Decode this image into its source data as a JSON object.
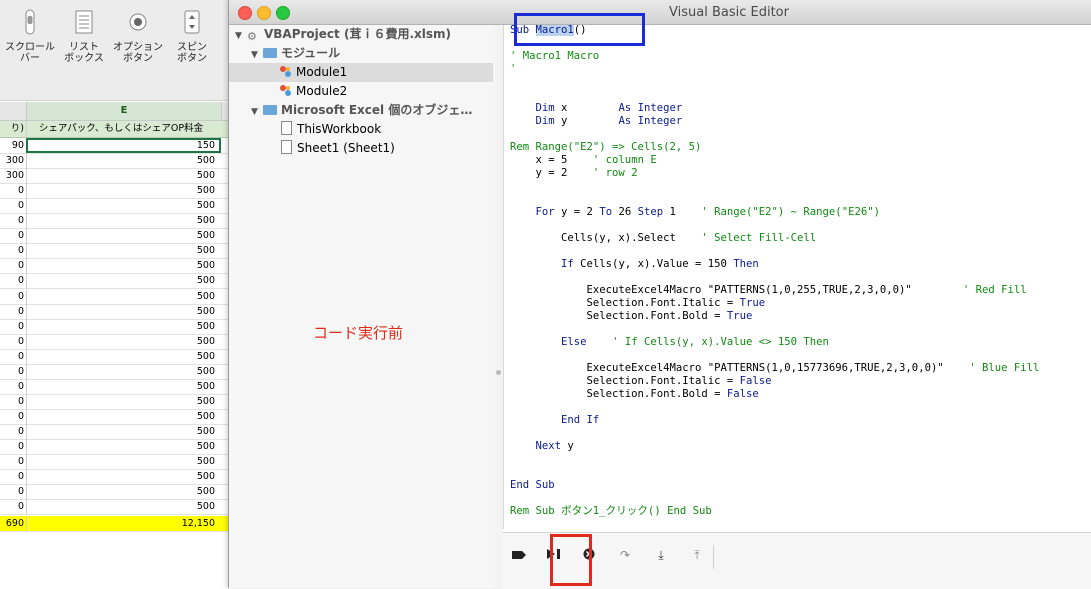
{
  "excel": {
    "ribbon": [
      {
        "icon": "scrollbar-icon",
        "label": "スクロール\nバー"
      },
      {
        "icon": "listbox-icon",
        "label": "リスト\nボックス"
      },
      {
        "icon": "option-button-icon",
        "label": "オプション\nボタン"
      },
      {
        "icon": "spin-button-icon",
        "label": "スピン\nボタン"
      }
    ],
    "column_letter": "E",
    "header_a": "り)",
    "header_e": "シェアパック、もしくはシェアOP料金",
    "rows": [
      {
        "a": "90",
        "e": "150"
      },
      {
        "a": "300",
        "e": "500"
      },
      {
        "a": "300",
        "e": "500"
      },
      {
        "a": "0",
        "e": "500"
      },
      {
        "a": "0",
        "e": "500"
      },
      {
        "a": "0",
        "e": "500"
      },
      {
        "a": "0",
        "e": "500"
      },
      {
        "a": "0",
        "e": "500"
      },
      {
        "a": "0",
        "e": "500"
      },
      {
        "a": "0",
        "e": "500"
      },
      {
        "a": "0",
        "e": "500"
      },
      {
        "a": "0",
        "e": "500"
      },
      {
        "a": "0",
        "e": "500"
      },
      {
        "a": "0",
        "e": "500"
      },
      {
        "a": "0",
        "e": "500"
      },
      {
        "a": "0",
        "e": "500"
      },
      {
        "a": "0",
        "e": "500"
      },
      {
        "a": "0",
        "e": "500"
      },
      {
        "a": "0",
        "e": "500"
      },
      {
        "a": "0",
        "e": "500"
      },
      {
        "a": "0",
        "e": "500"
      },
      {
        "a": "0",
        "e": "500"
      },
      {
        "a": "0",
        "e": "500"
      },
      {
        "a": "0",
        "e": "500"
      },
      {
        "a": "0",
        "e": "500"
      }
    ],
    "total": {
      "a": "690",
      "e": "12,150"
    },
    "total_color": "#ffff00"
  },
  "vbe": {
    "title": "Visual Basic Editor",
    "project": {
      "root": "VBAProject (茸ｉ６費用.xlsm)",
      "group_modules": "モジュール",
      "modules": [
        "Module1",
        "Module2"
      ],
      "group_objects": "Microsoft Excel 個のオブジェ…",
      "objects": [
        "ThisWorkbook",
        "Sheet1 (Sheet1)"
      ]
    },
    "annotation": "コード実行前",
    "annotation_color": "#e02b1a",
    "code_lines": [
      {
        "segs": [
          [
            "kw",
            "Sub "
          ],
          [
            "sel",
            "Macro1"
          ],
          [
            "",
            "()"
          ]
        ]
      },
      {
        "segs": []
      },
      {
        "segs": [
          [
            "cm",
            "' Macro1 Macro"
          ]
        ]
      },
      {
        "segs": [
          [
            "cm",
            "'"
          ]
        ]
      },
      {
        "segs": []
      },
      {
        "segs": []
      },
      {
        "segs": [
          [
            "kw",
            "    Dim "
          ],
          [
            "",
            "x        "
          ],
          [
            "kw",
            "As Integer"
          ]
        ]
      },
      {
        "segs": [
          [
            "kw",
            "    Dim "
          ],
          [
            "",
            "y        "
          ],
          [
            "kw",
            "As Integer"
          ]
        ]
      },
      {
        "segs": []
      },
      {
        "segs": [
          [
            "cm",
            "Rem Range(\"E2\") => Cells(2, 5)"
          ]
        ]
      },
      {
        "segs": [
          [
            "",
            "    x = 5    "
          ],
          [
            "cm",
            "' column E"
          ]
        ]
      },
      {
        "segs": [
          [
            "",
            "    y = 2    "
          ],
          [
            "cm",
            "' row 2"
          ]
        ]
      },
      {
        "segs": []
      },
      {
        "segs": []
      },
      {
        "segs": [
          [
            "kw",
            "    For "
          ],
          [
            "",
            "y = 2 "
          ],
          [
            "kw",
            "To "
          ],
          [
            "",
            "26 "
          ],
          [
            "kw",
            "Step "
          ],
          [
            "",
            "1    "
          ],
          [
            "cm",
            "' Range(\"E2\") ~ Range(\"E26\")"
          ]
        ]
      },
      {
        "segs": []
      },
      {
        "segs": [
          [
            "",
            "        Cells(y, x).Select    "
          ],
          [
            "cm",
            "' Select Fill-Cell"
          ]
        ]
      },
      {
        "segs": []
      },
      {
        "segs": [
          [
            "kw",
            "        If "
          ],
          [
            "",
            "Cells(y, x).Value = 150 "
          ],
          [
            "kw",
            "Then"
          ]
        ]
      },
      {
        "segs": []
      },
      {
        "segs": [
          [
            "",
            "            ExecuteExcel4Macro \"PATTERNS(1,0,255,TRUE,2,3,0,0)\"        "
          ],
          [
            "cm",
            "' Red Fill"
          ]
        ]
      },
      {
        "segs": [
          [
            "",
            "            Selection.Font.Italic = "
          ],
          [
            "kw",
            "True"
          ]
        ]
      },
      {
        "segs": [
          [
            "",
            "            Selection.Font.Bold = "
          ],
          [
            "kw",
            "True"
          ]
        ]
      },
      {
        "segs": []
      },
      {
        "segs": [
          [
            "kw",
            "        Else    "
          ],
          [
            "cm",
            "' If Cells(y, x).Value <> 150 Then"
          ]
        ]
      },
      {
        "segs": []
      },
      {
        "segs": [
          [
            "",
            "            ExecuteExcel4Macro \"PATTERNS(1,0,15773696,TRUE,2,3,0,0)\"    "
          ],
          [
            "cm",
            "' Blue Fill"
          ]
        ]
      },
      {
        "segs": [
          [
            "",
            "            Selection.Font.Italic = "
          ],
          [
            "kw",
            "False"
          ]
        ]
      },
      {
        "segs": [
          [
            "",
            "            Selection.Font.Bold = "
          ],
          [
            "kw",
            "False"
          ]
        ]
      },
      {
        "segs": []
      },
      {
        "segs": [
          [
            "kw",
            "        End If"
          ]
        ]
      },
      {
        "segs": []
      },
      {
        "segs": [
          [
            "kw",
            "    Next "
          ],
          [
            "",
            "y"
          ]
        ]
      },
      {
        "segs": []
      },
      {
        "segs": []
      },
      {
        "segs": [
          [
            "kw",
            "End Sub"
          ]
        ]
      },
      {
        "segs": []
      },
      {
        "segs": [
          [
            "cm",
            "Rem Sub ボタン1_クリック() End Sub"
          ]
        ]
      }
    ],
    "toolbar": [
      {
        "icon": "toggle-breakpoint-icon",
        "glyph": "⬛"
      },
      {
        "icon": "run-icon",
        "glyph": "▶"
      },
      {
        "icon": "reset-icon",
        "glyph": "⊗"
      },
      {
        "icon": "step-over-icon",
        "glyph": "↷"
      },
      {
        "icon": "step-into-icon",
        "glyph": "⤓"
      },
      {
        "icon": "step-out-icon",
        "glyph": "⤒"
      }
    ],
    "highlight_blue": "#1a2bd8",
    "highlight_red": "#e2281c"
  }
}
